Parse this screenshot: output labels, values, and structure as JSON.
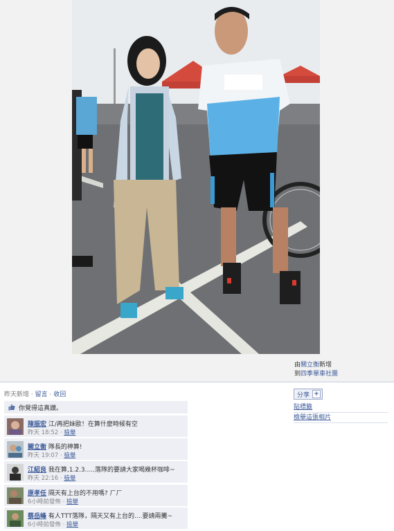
{
  "photo": {
    "alt": "photo",
    "caption": ""
  },
  "credit": {
    "prefix": "由",
    "author": "關立衡",
    "added": "新增",
    "to_prefix": "到",
    "album": "四季單車社團"
  },
  "meta": {
    "time": "昨天新增",
    "sep1": " · ",
    "comment_link": "留言",
    "sep2": " · ",
    "unlike_link": "收回"
  },
  "likes": {
    "text": "你覺得這真讚。"
  },
  "comments": [
    {
      "author": "陳振宏",
      "text": " 江/再把妹歐！在算什麼時候有空",
      "time": "昨天 18:52",
      "report": "檢舉"
    },
    {
      "author": "關立衡",
      "text": " 隊長的神算!",
      "time": "昨天 19:07",
      "report": "檢舉"
    },
    {
      "author": "江紹良",
      "text": " 我在算,1.2.3.....落隊的要請大家喝幾杯咖啡~",
      "time": "昨天 22:16",
      "report": "檢舉"
    },
    {
      "author": "原孝任",
      "text": " 隔天有上台的不用嗎? ㄏㄏ",
      "time": "6小時前發佈",
      "report": "檢舉"
    },
    {
      "author": "蔡岳峰",
      "text": " 有人TTT落隊，隔天又有上台的....要請兩攤~",
      "time": "6小時前發佈",
      "report": "檢舉"
    }
  ],
  "sidebar": {
    "share_label": "分享",
    "share_plus": "+",
    "tag_label": "貼標籤",
    "report_photo_label": "檢舉這張相片"
  },
  "colors": {
    "link": "#3b5998",
    "panel": "#edeff4"
  }
}
